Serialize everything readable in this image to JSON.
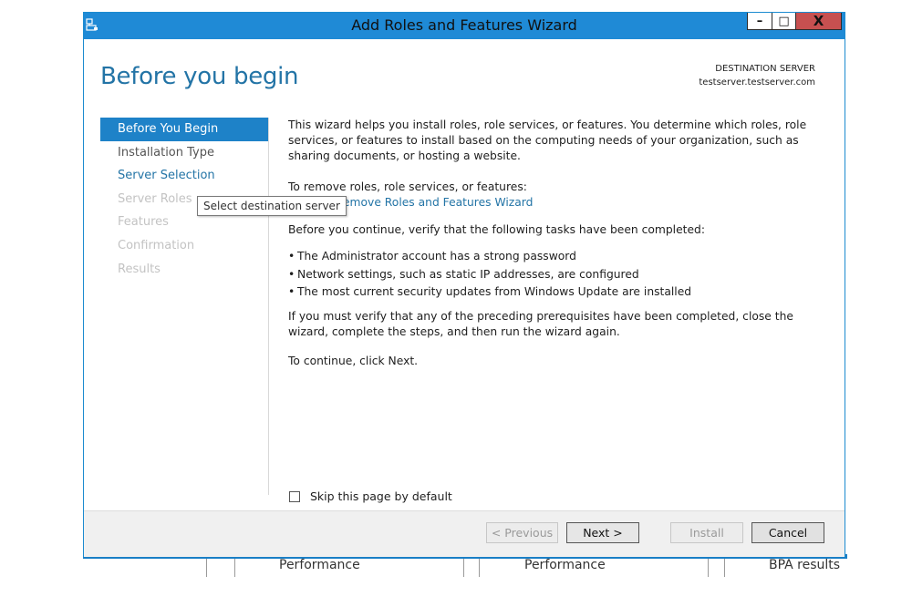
{
  "window": {
    "title": "Add Roles and Features Wizard",
    "minimize_glyph": "–",
    "maximize_glyph": "□",
    "close_glyph": "X"
  },
  "page": {
    "title": "Before you begin",
    "destination_label": "DESTINATION SERVER",
    "destination_server": "testserver.testserver.com"
  },
  "nav": {
    "items": [
      {
        "label": "Before You Begin",
        "state": "active"
      },
      {
        "label": "Installation Type",
        "state": "enabled"
      },
      {
        "label": "Server Selection",
        "state": "link"
      },
      {
        "label": "Server Roles",
        "state": "disabled"
      },
      {
        "label": "Features",
        "state": "disabled"
      },
      {
        "label": "Confirmation",
        "state": "disabled"
      },
      {
        "label": "Results",
        "state": "disabled"
      }
    ]
  },
  "tooltip": {
    "text": "Select destination server"
  },
  "main": {
    "intro": "This wizard helps you install roles, role services, or features. You determine which roles, role services, or features to install based on the computing needs of your organization, such as sharing documents, or hosting a website.",
    "remove_label": "To remove roles, role services, or features:",
    "remove_link": "Remove Roles and Features Wizard",
    "verify": "Before you continue, verify that the following tasks have been completed:",
    "bullets": [
      "The Administrator account has a strong password",
      "Network settings, such as static IP addresses, are configured",
      "The most current security updates from Windows Update are installed"
    ],
    "prereq": "If you must verify that any of the preceding prerequisites have been completed, close the wizard, complete the steps, and then run the wizard again.",
    "continue": "To continue, click Next."
  },
  "skip": {
    "label": "Skip this page by default",
    "checked": false
  },
  "footer": {
    "previous": "< Previous",
    "next": "Next >",
    "install": "Install",
    "cancel": "Cancel"
  },
  "background": {
    "col1": "Performance",
    "col2": "Performance",
    "col3": "BPA results"
  },
  "colors": {
    "titlebar": "#1f8ad6",
    "accent": "#2374a6",
    "nav_active": "#1e82c8",
    "close_button": "#c75050"
  }
}
